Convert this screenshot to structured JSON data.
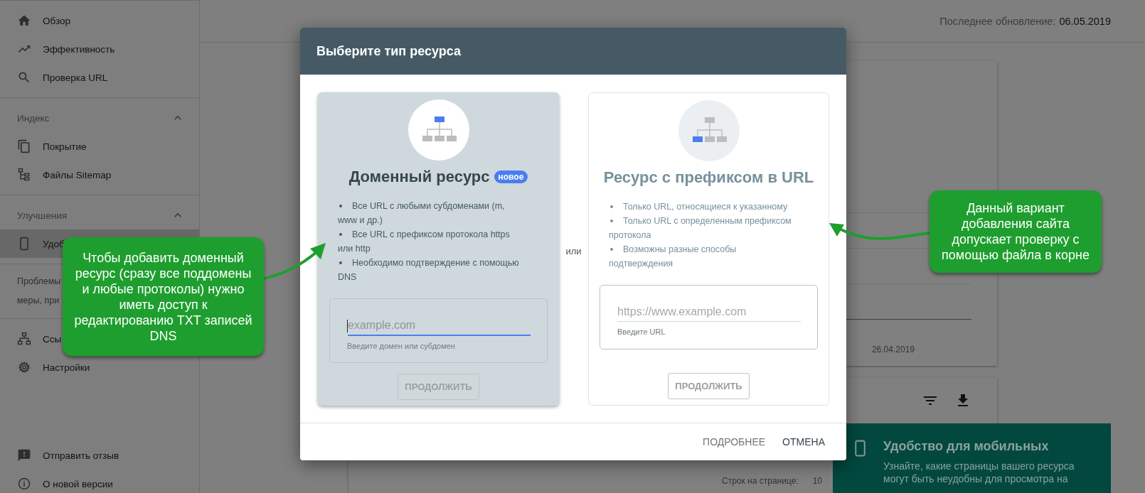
{
  "sidebar": {
    "sections": [
      {
        "items": [
          {
            "label": "Обзор",
            "selected": false
          },
          {
            "label": "Эффективность",
            "selected": false
          },
          {
            "label": "Проверка URL",
            "selected": false
          }
        ]
      },
      {
        "heading": "Индекс",
        "expanded": true,
        "items": [
          {
            "label": "Покрытие",
            "selected": false
          },
          {
            "label": "Файлы Sitemap",
            "selected": false
          }
        ]
      },
      {
        "heading": "Улучшения",
        "expanded": true,
        "items": [
          {
            "label": "Удоб",
            "selected": true
          }
        ]
      },
      {
        "note_lines": [
          "Проблемы",
          "меры, при"
        ]
      },
      {
        "items": [
          {
            "label": "Ссы",
            "selected": false
          },
          {
            "label": "Настройки",
            "selected": false
          }
        ]
      }
    ],
    "footer_items": [
      {
        "label": "Отправить отзыв"
      },
      {
        "label": "О новой версии"
      }
    ]
  },
  "header": {
    "label": "Последнее обновление:",
    "value": "06.05.2019"
  },
  "report_card": {
    "date": "26.04.2019"
  },
  "table_card": {
    "rows_per_page_label": "Строк на странице:",
    "rows_per_page": "10"
  },
  "snackbar": {
    "title": "Удобство для мобильных",
    "text": "Узнайте, какие страницы вашего ресурса могут быть неудобны для просмотра на"
  },
  "modal": {
    "title": "Выберите тип ресурса",
    "separator": "или",
    "cards": [
      {
        "kind": "domain",
        "title": "Доменный ресурс",
        "badge": "новое",
        "selected": true,
        "bullets": [
          "Все URL с любыми субдоменами (m, www и др.)",
          "Все URL с префиксом протокола https или http",
          "Необходимо подтверждение с помощью DNS"
        ],
        "field": {
          "placeholder": "example.com",
          "helper": "Введите домен или субдомен",
          "focused": true
        },
        "button": {
          "label": "ПРОДОЛЖИТЬ",
          "disabled": true
        }
      },
      {
        "kind": "url_prefix",
        "title": "Ресурс с префиксом в URL",
        "selected": false,
        "bullets": [
          "Только URL, относящиеся к указанному",
          "Только URL с определенным префиксом протокола",
          "Возможны разные способы подтверждения"
        ],
        "field": {
          "placeholder": "https://www.example.com",
          "helper": "Введите URL",
          "focused": false
        },
        "button": {
          "label": "ПРОДОЛЖИТЬ",
          "disabled": true
        }
      }
    ],
    "actions": [
      {
        "label": "ПОДРОБНЕЕ",
        "kind": "secondary"
      },
      {
        "label": "ОТМЕНА",
        "kind": "primary"
      }
    ]
  },
  "annotations": [
    {
      "text": "Чтобы добавить доменный ресурс  (сразу все поддомены и любые протоколы) нужно иметь доступ к редактированию TXT записей DNS"
    },
    {
      "text": "Данный вариант добавления сайта допускает проверку с помощью файла в корне"
    }
  ]
}
